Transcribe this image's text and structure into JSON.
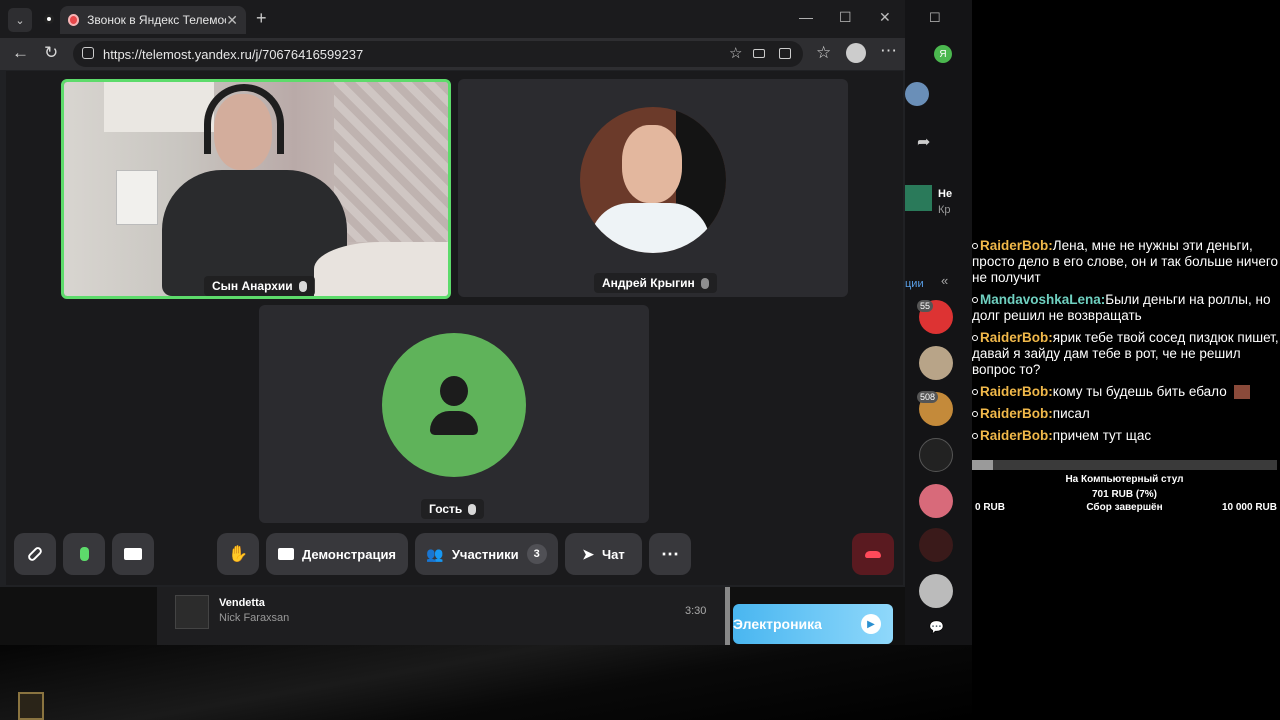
{
  "browser": {
    "tab_title": "Звонок в Яндекс Телемосте",
    "url": "https://telemost.yandex.ru/j/70676416599237"
  },
  "call": {
    "participants": [
      {
        "name": "Сын Анархии"
      },
      {
        "name": "Андрей Крыгин"
      },
      {
        "name": "Гость"
      }
    ],
    "toolbar": {
      "screen_share": "Демонстрация",
      "participants": "Участники",
      "participants_count": "3",
      "chat": "Чат"
    }
  },
  "music": {
    "track_title": "Vendetta",
    "artist": "Nick Faraxsan",
    "duration": "3:30",
    "genre_button": "Электроника"
  },
  "side": {
    "badge1": "55",
    "badge2": "508",
    "text1": "Не",
    "text2": "Кр",
    "link": "ции"
  },
  "chat": {
    "messages": [
      {
        "user": "RaiderBob:",
        "text": "Лена, мне не нужны эти деньги, просто дело в его слове, он и так больше ничего не получит",
        "color": "#f0b84a"
      },
      {
        "user": "MandavoshkaLena:",
        "text": "Были деньги на роллы, но долг решил не возвращать",
        "color": "#6fd0c0"
      },
      {
        "user": "RaiderBob:",
        "text": "ярик тебе твой сосед пиздюк пишет, давай я зайду дам тебе в рот, че не решил вопрос то?",
        "color": "#f0b84a"
      },
      {
        "user": "RaiderBob:",
        "text": "кому ты будешь бить ебало",
        "color": "#f0b84a"
      },
      {
        "user": "RaiderBob:",
        "text": "писал",
        "color": "#f0b84a"
      },
      {
        "user": "RaiderBob:",
        "text": "причем тут щас",
        "color": "#f0b84a"
      }
    ]
  },
  "donation": {
    "title": "На Компьютерный стул",
    "amount": "701 RUB (7%)",
    "min": "0 RUB",
    "status": "Сбор завершён",
    "max": "10 000 RUB",
    "progress": 0.07
  }
}
